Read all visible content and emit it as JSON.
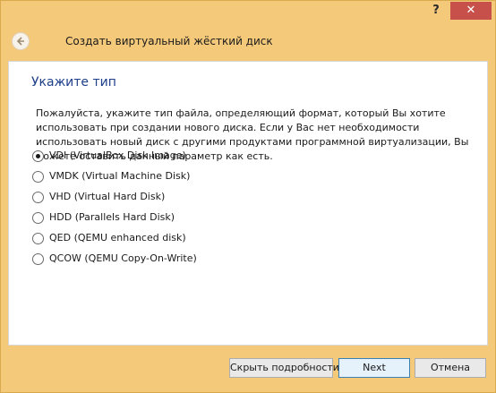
{
  "titlebar": {
    "help_symbol": "?",
    "close_symbol": "✕"
  },
  "header": {
    "title": "Создать виртуальный жёсткий диск"
  },
  "main": {
    "heading": "Укажите тип",
    "description": "Пожалуйста, укажите тип файла, определяющий формат, который Вы хотите использовать при создании нового диска. Если у Вас нет необходимости использовать новый диск с другими продуктами программной виртуализации, Вы можете оставить данный параметр как есть.",
    "options": [
      {
        "label": "VDI (VirtualBox Disk Image)",
        "selected": true
      },
      {
        "label": "VMDK (Virtual Machine Disk)",
        "selected": false
      },
      {
        "label": "VHD (Virtual Hard Disk)",
        "selected": false
      },
      {
        "label": "HDD (Parallels Hard Disk)",
        "selected": false
      },
      {
        "label": "QED (QEMU enhanced disk)",
        "selected": false
      },
      {
        "label": "QCOW (QEMU Copy-On-Write)",
        "selected": false
      }
    ]
  },
  "footer": {
    "hide_details_label": "Скрыть подробности",
    "next_label": "Next",
    "cancel_label": "Отмена"
  },
  "colors": {
    "frame": "#f5c97a",
    "close_button": "#c7504a",
    "heading_text": "#1e3f8a"
  }
}
